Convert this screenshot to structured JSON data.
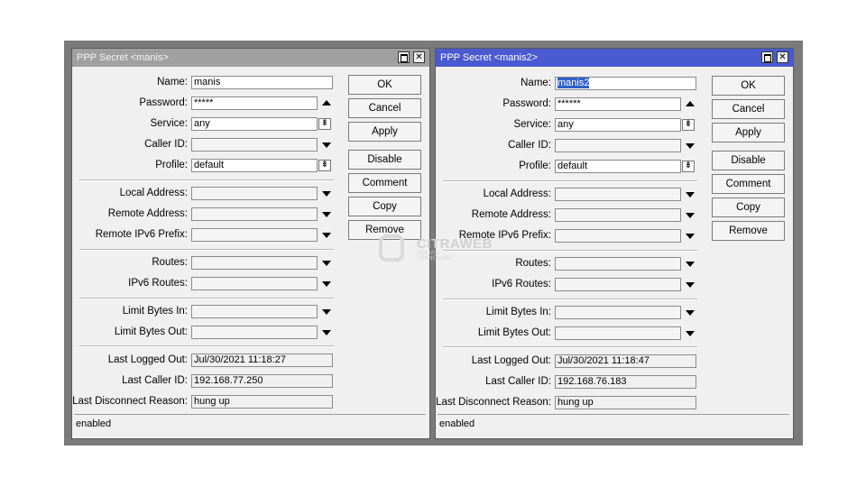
{
  "left": {
    "title": "PPP Secret <manis>",
    "fields": {
      "name": {
        "label": "Name:",
        "value": "manis"
      },
      "password": {
        "label": "Password:",
        "value": "*****"
      },
      "service": {
        "label": "Service:",
        "value": "any"
      },
      "caller_id": {
        "label": "Caller ID:",
        "value": ""
      },
      "profile": {
        "label": "Profile:",
        "value": "default"
      },
      "local_address": {
        "label": "Local Address:",
        "value": ""
      },
      "remote_address": {
        "label": "Remote Address:",
        "value": ""
      },
      "remote_ipv6_prefix": {
        "label": "Remote IPv6 Prefix:",
        "value": ""
      },
      "routes": {
        "label": "Routes:",
        "value": ""
      },
      "ipv6_routes": {
        "label": "IPv6 Routes:",
        "value": ""
      },
      "limit_bytes_in": {
        "label": "Limit Bytes In:",
        "value": ""
      },
      "limit_bytes_out": {
        "label": "Limit Bytes Out:",
        "value": ""
      },
      "last_logged_out": {
        "label": "Last Logged Out:",
        "value": "Jul/30/2021 11:18:27"
      },
      "last_caller_id": {
        "label": "Last Caller ID:",
        "value": "192.168.77.250"
      },
      "last_disconnect_reason": {
        "label": "Last Disconnect Reason:",
        "value": "hung up"
      }
    },
    "status": "enabled"
  },
  "right": {
    "title": "PPP Secret <manis2>",
    "fields": {
      "name": {
        "label": "Name:",
        "value": "manis2"
      },
      "password": {
        "label": "Password:",
        "value": "******"
      },
      "service": {
        "label": "Service:",
        "value": "any"
      },
      "caller_id": {
        "label": "Caller ID:",
        "value": ""
      },
      "profile": {
        "label": "Profile:",
        "value": "default"
      },
      "local_address": {
        "label": "Local Address:",
        "value": ""
      },
      "remote_address": {
        "label": "Remote Address:",
        "value": ""
      },
      "remote_ipv6_prefix": {
        "label": "Remote IPv6 Prefix:",
        "value": ""
      },
      "routes": {
        "label": "Routes:",
        "value": ""
      },
      "ipv6_routes": {
        "label": "IPv6 Routes:",
        "value": ""
      },
      "limit_bytes_in": {
        "label": "Limit Bytes In:",
        "value": ""
      },
      "limit_bytes_out": {
        "label": "Limit Bytes Out:",
        "value": ""
      },
      "last_logged_out": {
        "label": "Last Logged Out:",
        "value": "Jul/30/2021 11:18:47"
      },
      "last_caller_id": {
        "label": "Last Caller ID:",
        "value": "192.168.76.183"
      },
      "last_disconnect_reason": {
        "label": "Last Disconnect Reason:",
        "value": "hung up"
      }
    },
    "status": "enabled"
  },
  "buttons": {
    "ok": "OK",
    "cancel": "Cancel",
    "apply": "Apply",
    "disable": "Disable",
    "comment": "Comment",
    "copy": "Copy",
    "remove": "Remove"
  },
  "watermark": {
    "brand": "CITRAWEB",
    "tagline": "SOLUSI TEKNOLOGI"
  },
  "colors": {
    "active_title": "#4a5ad0",
    "inactive_title": "#a0a0a0",
    "selection": "#3060c8"
  }
}
